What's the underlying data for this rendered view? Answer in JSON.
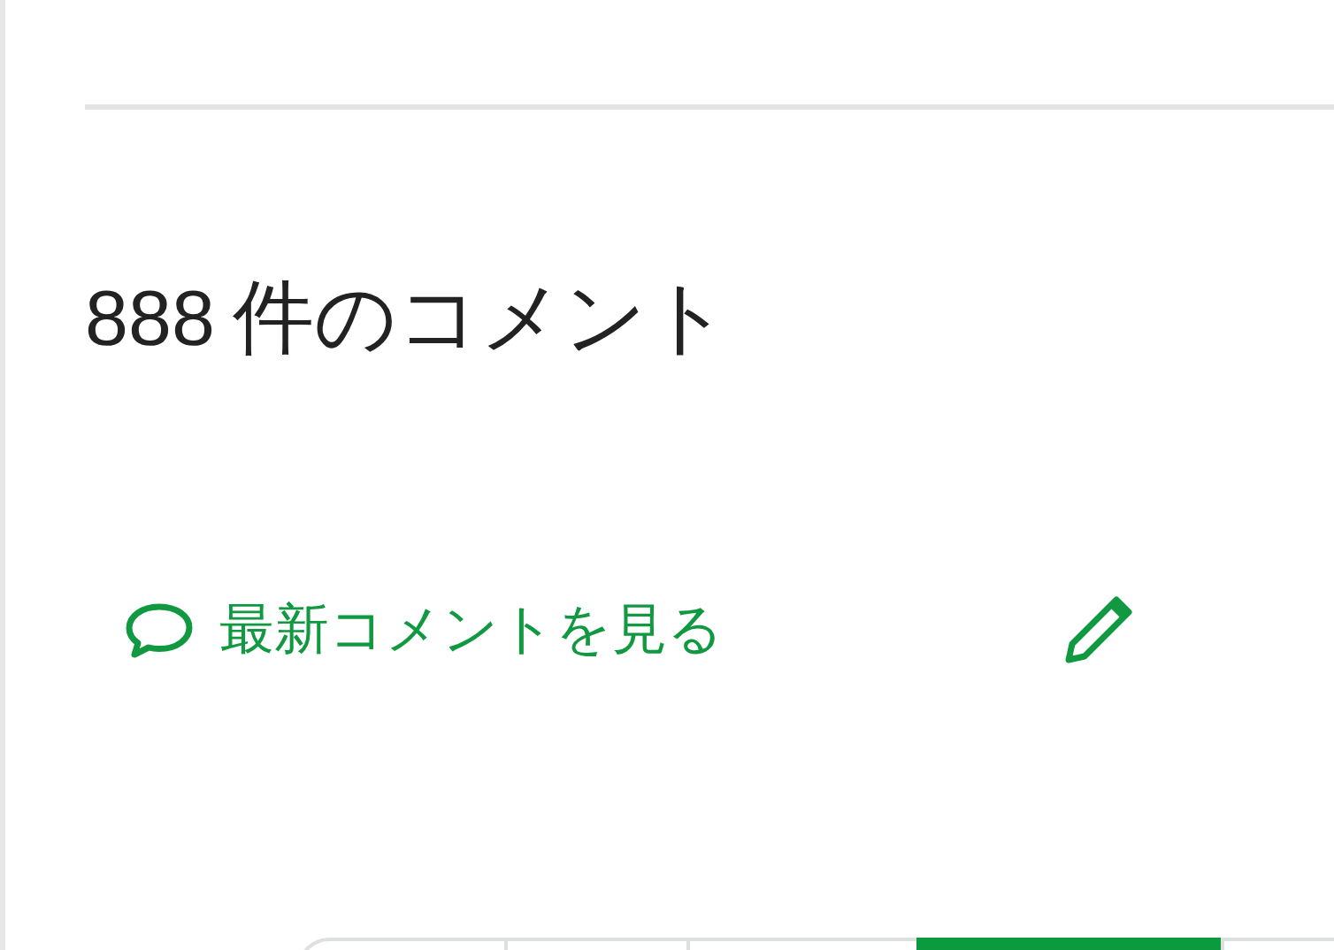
{
  "heading": {
    "count": "888",
    "label": "件のコメント"
  },
  "links": [
    {
      "kind": "comment",
      "label": "最新コメントを見る"
    },
    {
      "kind": "edit"
    }
  ],
  "tabs": [
    {
      "selected": false
    },
    {
      "selected": false
    },
    {
      "selected": false
    },
    {
      "selected": true
    },
    {
      "selected": false
    }
  ]
}
